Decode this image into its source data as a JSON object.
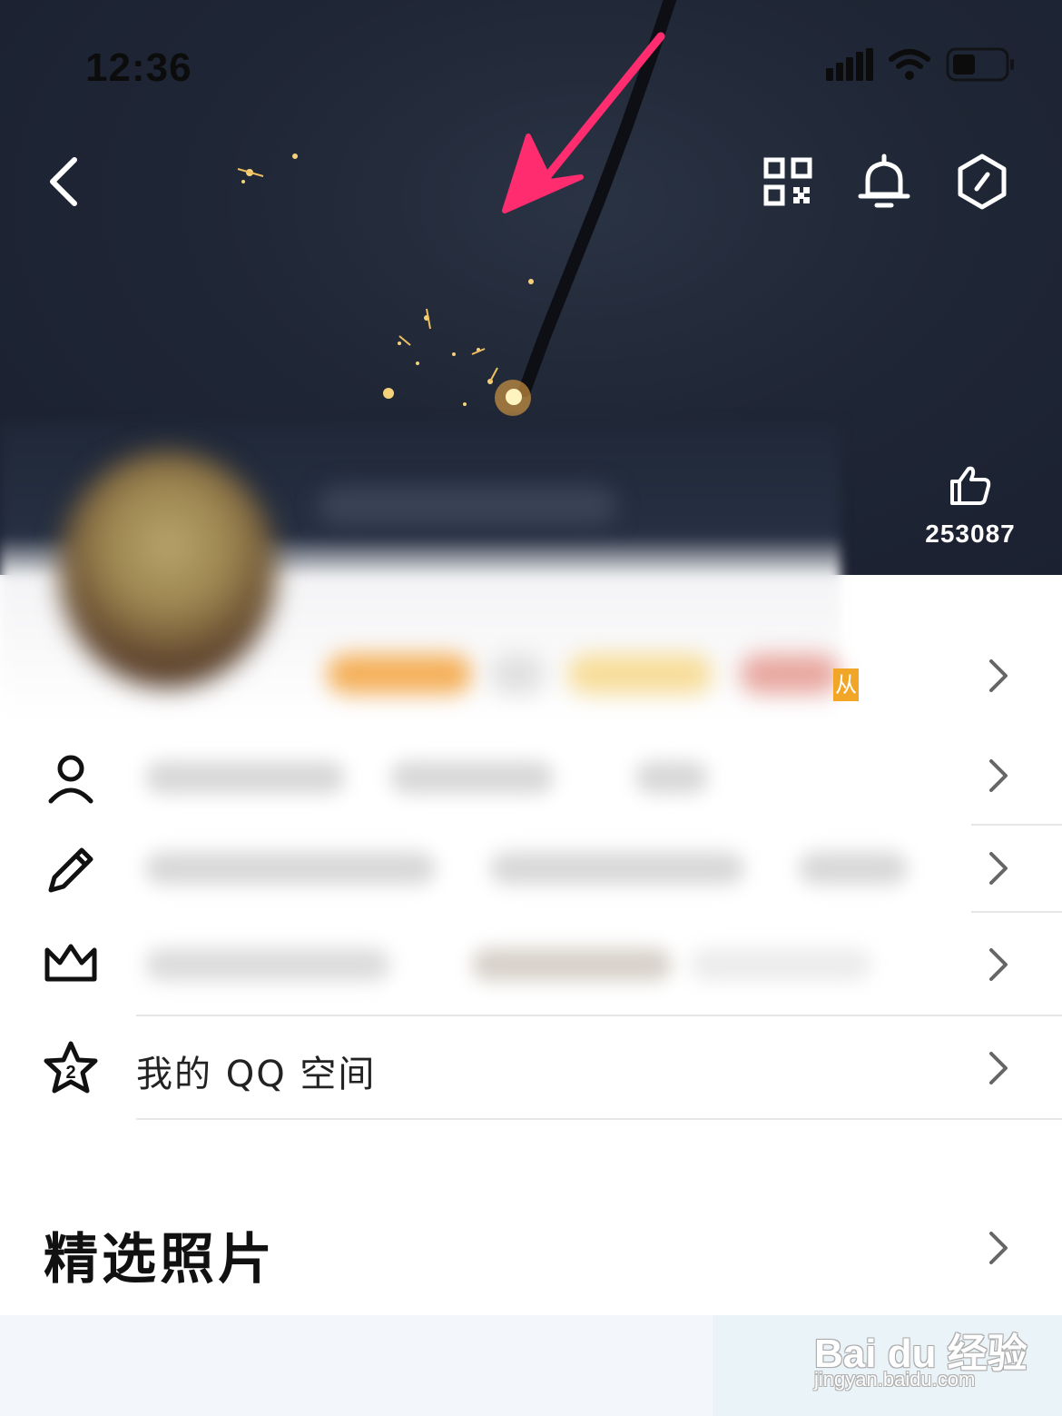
{
  "status_bar": {
    "time": "12:36",
    "icons": [
      "cellular-signal-icon",
      "wifi-icon",
      "battery-icon"
    ]
  },
  "header": {
    "icons": [
      "back-arrow-icon",
      "qr-code-icon",
      "bell-icon",
      "settings-hexagon-icon"
    ]
  },
  "cover": {
    "like_icon": "thumbs-up-icon",
    "like_count": "253087",
    "annotation_arrow_color": "#ff2d6f"
  },
  "profile": {
    "badge_partial_text": "从"
  },
  "menu": {
    "items": [
      {
        "icon": "person-icon"
      },
      {
        "icon": "pencil-icon"
      },
      {
        "icon": "crown-icon"
      },
      {
        "icon": "qzone-star-icon",
        "label": "我的 QQ 空间"
      }
    ]
  },
  "sections": {
    "photos_title": "精选照片"
  },
  "watermark": {
    "logo": "Bai du 经验",
    "url": "jingyan.baidu.com"
  },
  "colors": {
    "cover_bg": "#1f2635",
    "accent_arrow": "#ff2d6f",
    "photos_bg": "#f3f7fb"
  }
}
